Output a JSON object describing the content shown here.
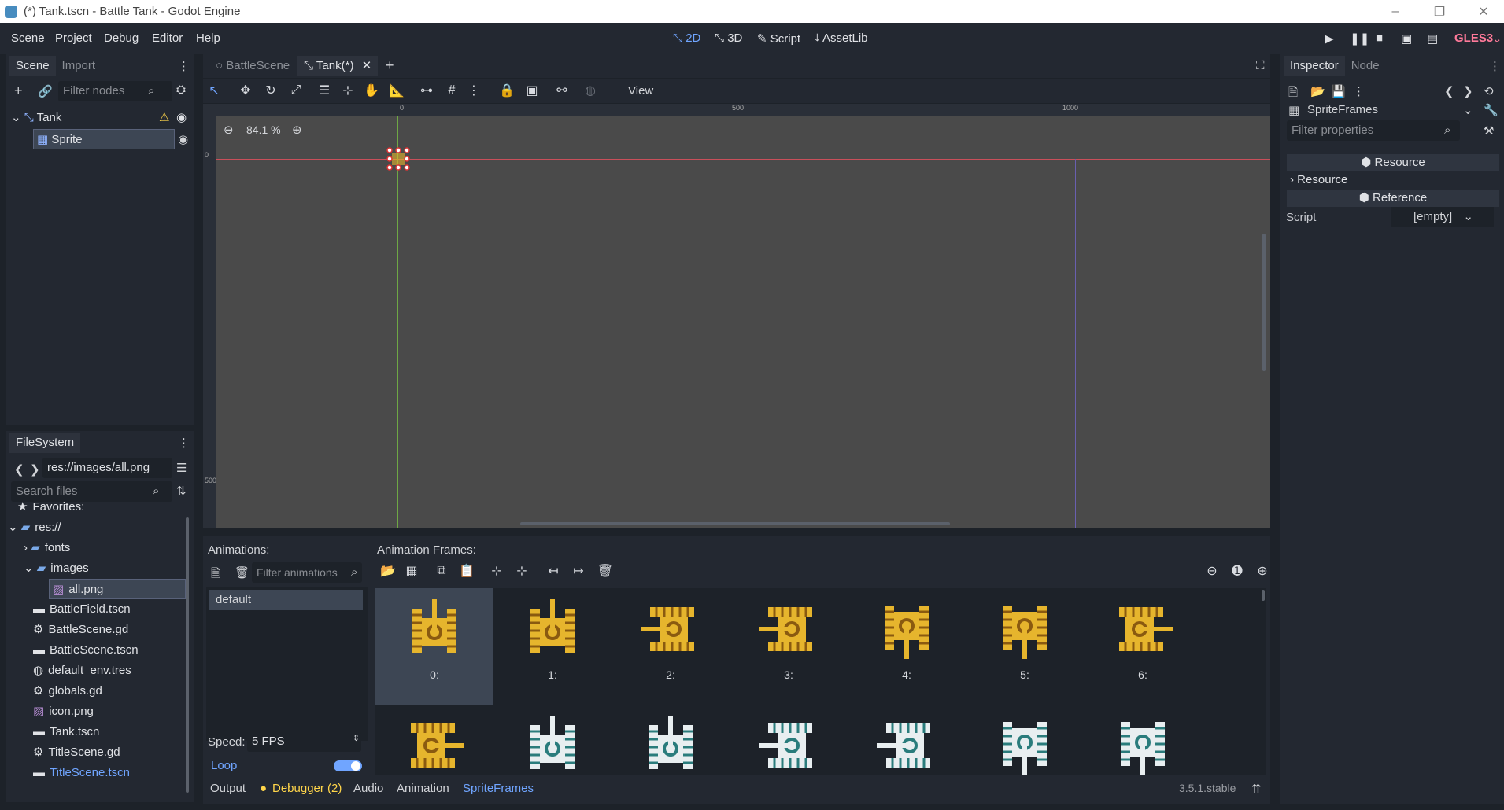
{
  "window": {
    "title": "(*) Tank.tscn - Battle Tank - Godot Engine"
  },
  "menu": {
    "items": [
      "Scene",
      "Project",
      "Debug",
      "Editor",
      "Help"
    ]
  },
  "modes": {
    "m2d": "2D",
    "m3d": "3D",
    "script": "Script",
    "assetlib": "AssetLib"
  },
  "renderer": "GLES3",
  "scene_dock": {
    "tabs": [
      "Scene",
      "Import"
    ],
    "filter_placeholder": "Filter nodes",
    "nodes": [
      {
        "name": "Tank"
      },
      {
        "name": "Sprite"
      }
    ]
  },
  "filesystem": {
    "title": "FileSystem",
    "path": "res://images/all.png",
    "search_placeholder": "Search files",
    "items": [
      {
        "name": "Favorites:",
        "icon": "star-icon"
      },
      {
        "name": "res://",
        "icon": "folder-icon"
      },
      {
        "name": "fonts",
        "icon": "folder-icon"
      },
      {
        "name": "images",
        "icon": "folder-icon"
      },
      {
        "name": "all.png",
        "icon": "image-icon"
      },
      {
        "name": "BattleField.tscn",
        "icon": "scene-icon"
      },
      {
        "name": "BattleScene.gd",
        "icon": "gear-icon"
      },
      {
        "name": "BattleScene.tscn",
        "icon": "scene-icon"
      },
      {
        "name": "default_env.tres",
        "icon": "globe-icon"
      },
      {
        "name": "globals.gd",
        "icon": "gear-icon"
      },
      {
        "name": "icon.png",
        "icon": "image-icon"
      },
      {
        "name": "Tank.tscn",
        "icon": "scene-icon"
      },
      {
        "name": "TitleScene.gd",
        "icon": "gear-icon"
      },
      {
        "name": "TitleScene.tscn",
        "icon": "scene-icon"
      }
    ]
  },
  "editor_tabs": [
    "BattleScene",
    "Tank(*)"
  ],
  "viewport": {
    "zoom": "84.1 %",
    "view_label": "View",
    "ruler_h": [
      "0",
      "500",
      "1000"
    ],
    "ruler_v": [
      "0",
      "500"
    ]
  },
  "animation_panel": {
    "animations_label": "Animations:",
    "frames_label": "Animation Frames:",
    "filter_placeholder": "Filter animations",
    "animations": [
      "default"
    ],
    "speed_label": "Speed:",
    "speed_value": "5 FPS",
    "loop_label": "Loop",
    "loop_on": true,
    "frames": [
      "0:",
      "1:",
      "2:",
      "3:",
      "4:",
      "5:",
      "6:"
    ]
  },
  "bottom_bar": {
    "tabs": [
      "Output",
      "Debugger (2)",
      "Audio",
      "Animation",
      "SpriteFrames"
    ],
    "version": "3.5.1.stable"
  },
  "inspector": {
    "tabs": [
      "Inspector",
      "Node"
    ],
    "resource_type": "SpriteFrames",
    "filter_placeholder": "Filter properties",
    "section_resource": "Resource",
    "subsection_resource": "Resource",
    "section_reference": "Reference",
    "script_label": "Script",
    "script_value": "[empty]"
  },
  "colors": {
    "accent": "#70a5ff",
    "warning": "#ffd54a",
    "tank_yellow": "#e6b52d",
    "tank_white": "#e8eef0",
    "tank_teal": "#2a7c7c"
  }
}
